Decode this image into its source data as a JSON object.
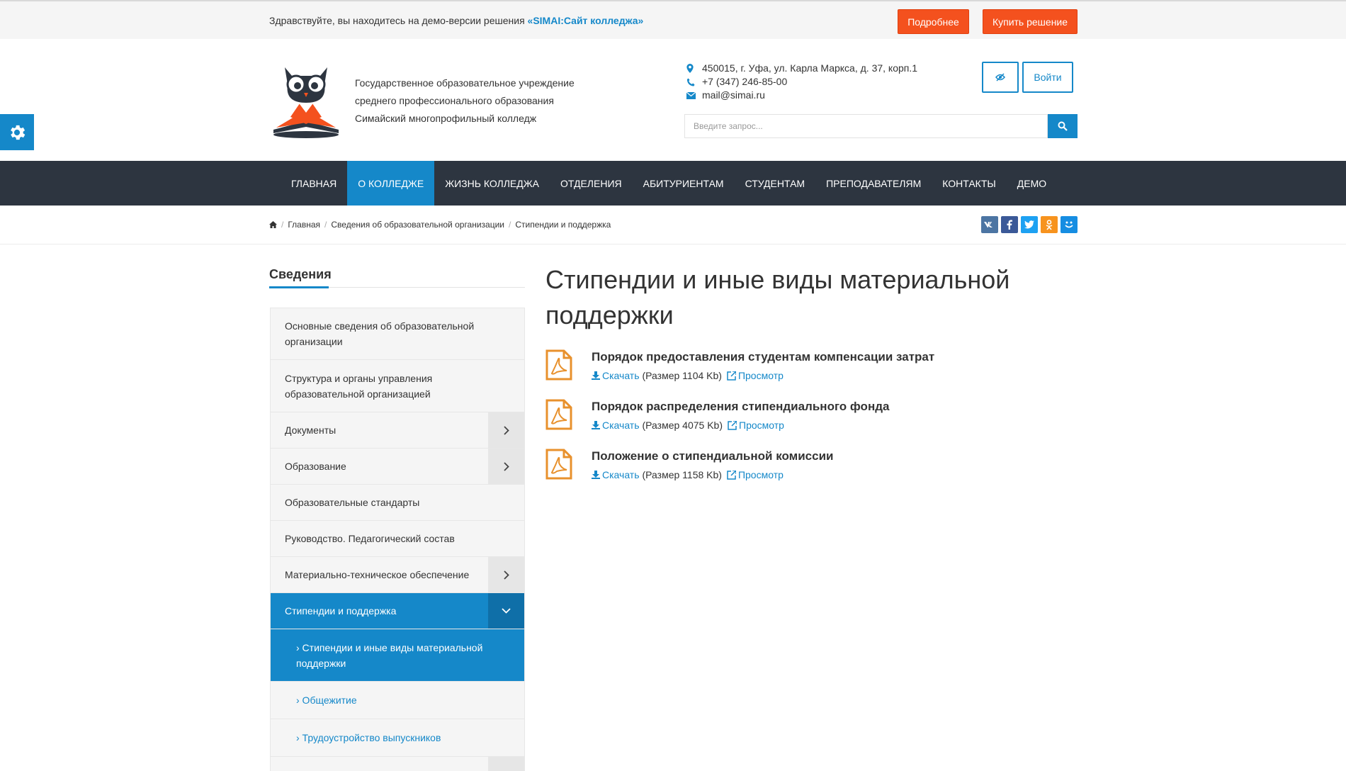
{
  "demo_bar": {
    "text": "Здравствуйте, вы находитесь на демо-версии решения",
    "product": "«SIMAI:Сайт колледжа»",
    "more_label": "Подробнее",
    "buy_label": "Купить решение"
  },
  "header": {
    "org_line1": "Государственное образовательное учреждение",
    "org_line2": "среднего профессионального образования",
    "org_line3": "Симайский многопрофильный колледж",
    "address": "450015, г. Уфа, ул. Карла Маркса, д. 37, корп.1",
    "phone": "+7 (347) 246-85-00",
    "email": "mail@simai.ru",
    "login_label": "Войти",
    "search_placeholder": "Введите запрос..."
  },
  "nav": {
    "items": [
      "ГЛАВНАЯ",
      "О КОЛЛЕДЖЕ",
      "ЖИЗНЬ КОЛЛЕДЖА",
      "ОТДЕЛЕНИЯ",
      "АБИТУРИЕНТАМ",
      "СТУДЕНТАМ",
      "ПРЕПОДАВАТЕЛЯМ",
      "КОНТАКТЫ",
      "ДЕМО"
    ],
    "active": "О КОЛЛЕДЖЕ"
  },
  "breadcrumb": [
    "Главная",
    "Сведения об образовательной организации",
    "Стипендии и поддержка"
  ],
  "share_icons": [
    "vk-icon",
    "facebook-icon",
    "twitter-icon",
    "odnoklassniki-icon",
    "moimir-icon"
  ],
  "sidebar": {
    "title": "Сведения",
    "items": [
      {
        "label": "Основные сведения об образовательной организации"
      },
      {
        "label": "Структура и органы управления образовательной организацией"
      },
      {
        "label": "Документы"
      },
      {
        "label": "Образование"
      },
      {
        "label": "Образовательные стандарты"
      },
      {
        "label": "Руководство. Педагогический состав"
      },
      {
        "label": "Материально-техническое обеспечение"
      },
      {
        "label": "Стипендии и поддержка"
      }
    ],
    "subitems": [
      {
        "label": "› Стипендии и иные виды материальной поддержки"
      },
      {
        "label": "› Общежитие"
      },
      {
        "label": "› Трудоустройство выпускников"
      }
    ]
  },
  "main": {
    "title": "Стипендии и иные виды материальной поддержки",
    "download_label": "Скачать",
    "view_label": "Просмотр",
    "documents": [
      {
        "title": "Порядок предоставления студентам компенсации затрат",
        "size": "(Размер 1104 Kb)"
      },
      {
        "title": "Порядок распределения стипендиального фонда",
        "size": "(Размер 4075 Kb)"
      },
      {
        "title": "Положение о стипендиальной комиссии",
        "size": "(Размер 1158 Kb)"
      }
    ]
  },
  "colors": {
    "accent": "#1588c9",
    "demo_button": "#f4511e",
    "nav_bg": "#2d3540",
    "doc_icon": "#e8912d"
  }
}
